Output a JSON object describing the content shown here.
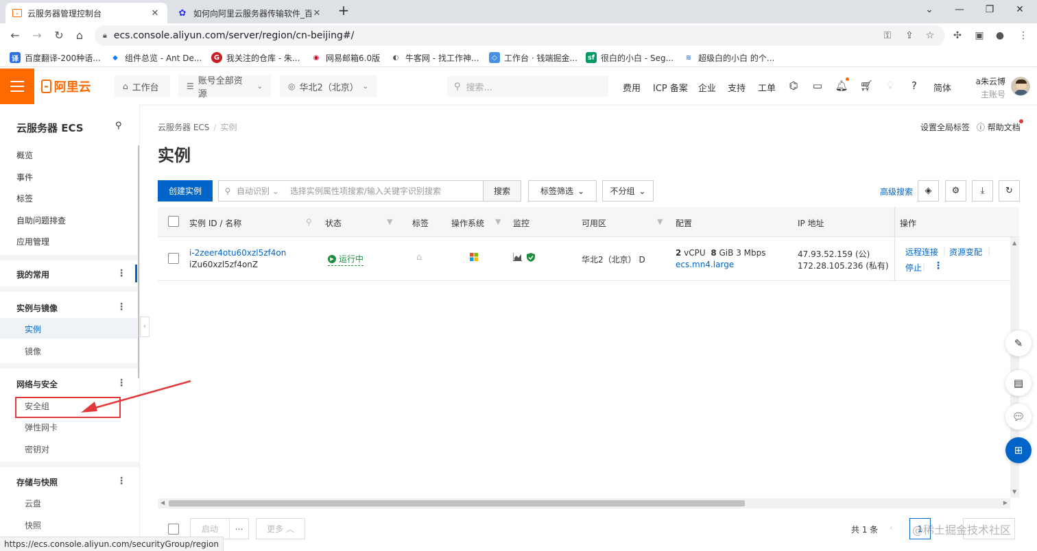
{
  "browser": {
    "tabs": [
      {
        "title": "云服务器管理控制台",
        "active": true
      },
      {
        "title": "如何向阿里云服务器传输软件_百",
        "active": false
      }
    ],
    "url": "ecs.console.aliyun.com/server/region/cn-beijing#/",
    "bookmarks": [
      {
        "label": "百度翻译-200种语...",
        "icon_text": "译",
        "color": "#2f6fe4"
      },
      {
        "label": "组件总览 - Ant De...",
        "icon_text": "◆",
        "color": "#1677ff"
      },
      {
        "label": "我关注的仓库 - 朱...",
        "icon_text": "G",
        "color": "#c71d23"
      },
      {
        "label": "网易邮箱6.0版",
        "icon_text": "◉",
        "color": "#d0021b"
      },
      {
        "label": "牛客网 - 找工作神...",
        "icon_text": "◐",
        "color": "#555555"
      },
      {
        "label": "工作台 · 钱端掘金...",
        "icon_text": "◇",
        "color": "#4a90e2"
      },
      {
        "label": "很白的小白 - Seg...",
        "icon_text": "sf",
        "color": "#009a61"
      },
      {
        "label": "超级白的小白 的个...",
        "icon_text": "≋",
        "color": "#3b7ddd"
      }
    ],
    "status_url": "https://ecs.console.aliyun.com/securityGroup/region"
  },
  "header": {
    "logo_text": "阿里云",
    "workbench": "工作台",
    "resources": "账号全部资源",
    "region": "华北2（北京）",
    "search_placeholder": "搜索...",
    "links": [
      "费用",
      "ICP 备案",
      "企业",
      "支持",
      "工单"
    ],
    "lang": "简体",
    "user_name": "a朱云博",
    "user_role": "主账号"
  },
  "sidebar": {
    "title": "云服务器 ECS",
    "top_items": [
      "概览",
      "事件",
      "标签",
      "自助问题排查",
      "应用管理"
    ],
    "favorites": "我的常用",
    "groups": [
      {
        "label": "实例与镜像",
        "items": [
          "实例",
          "镜像"
        ]
      },
      {
        "label": "网络与安全",
        "items": [
          "安全组",
          "弹性网卡",
          "密钥对"
        ]
      },
      {
        "label": "存储与快照",
        "items": [
          "云盘",
          "快照"
        ]
      }
    ]
  },
  "main": {
    "breadcrumb": [
      "云服务器 ECS",
      "实例"
    ],
    "title": "实例",
    "set_global_tags": "设置全局标签",
    "help_docs": "帮助文档",
    "create_button": "创建实例",
    "auto_detect": "自动识别",
    "search_placeholder": "选择实例属性项搜索/输入关键字识别搜索",
    "search_button": "搜索",
    "tag_filter": "标签筛选",
    "group_select": "不分组",
    "advanced_search": "高级搜索",
    "columns": [
      "实例 ID / 名称",
      "状态",
      "标签",
      "操作系统",
      "监控",
      "可用区",
      "配置",
      "IP 地址",
      "操作"
    ],
    "rows": [
      {
        "id": "i-2zeer4otu60xzl5zf4on",
        "name": "iZu60xzl5zf4onZ",
        "status": "运行中",
        "zone": "华北2（北京） D",
        "vcpu": "2",
        "vcpu_unit": " vCPU",
        "mem": "8",
        "mem_unit": " GiB",
        "bandwidth": " 3 Mbps",
        "spec": "ecs.mn4.large",
        "ip_public": "47.93.52.159 (公)",
        "ip_private": "172.28.105.236 (私有)",
        "actions": [
          "远程连接",
          "资源变配",
          "停止"
        ]
      }
    ],
    "footer": {
      "start": "启动",
      "more": "更多",
      "total": "共 1 条",
      "page": "1"
    },
    "watermark": "@稀土掘金技术社区"
  }
}
